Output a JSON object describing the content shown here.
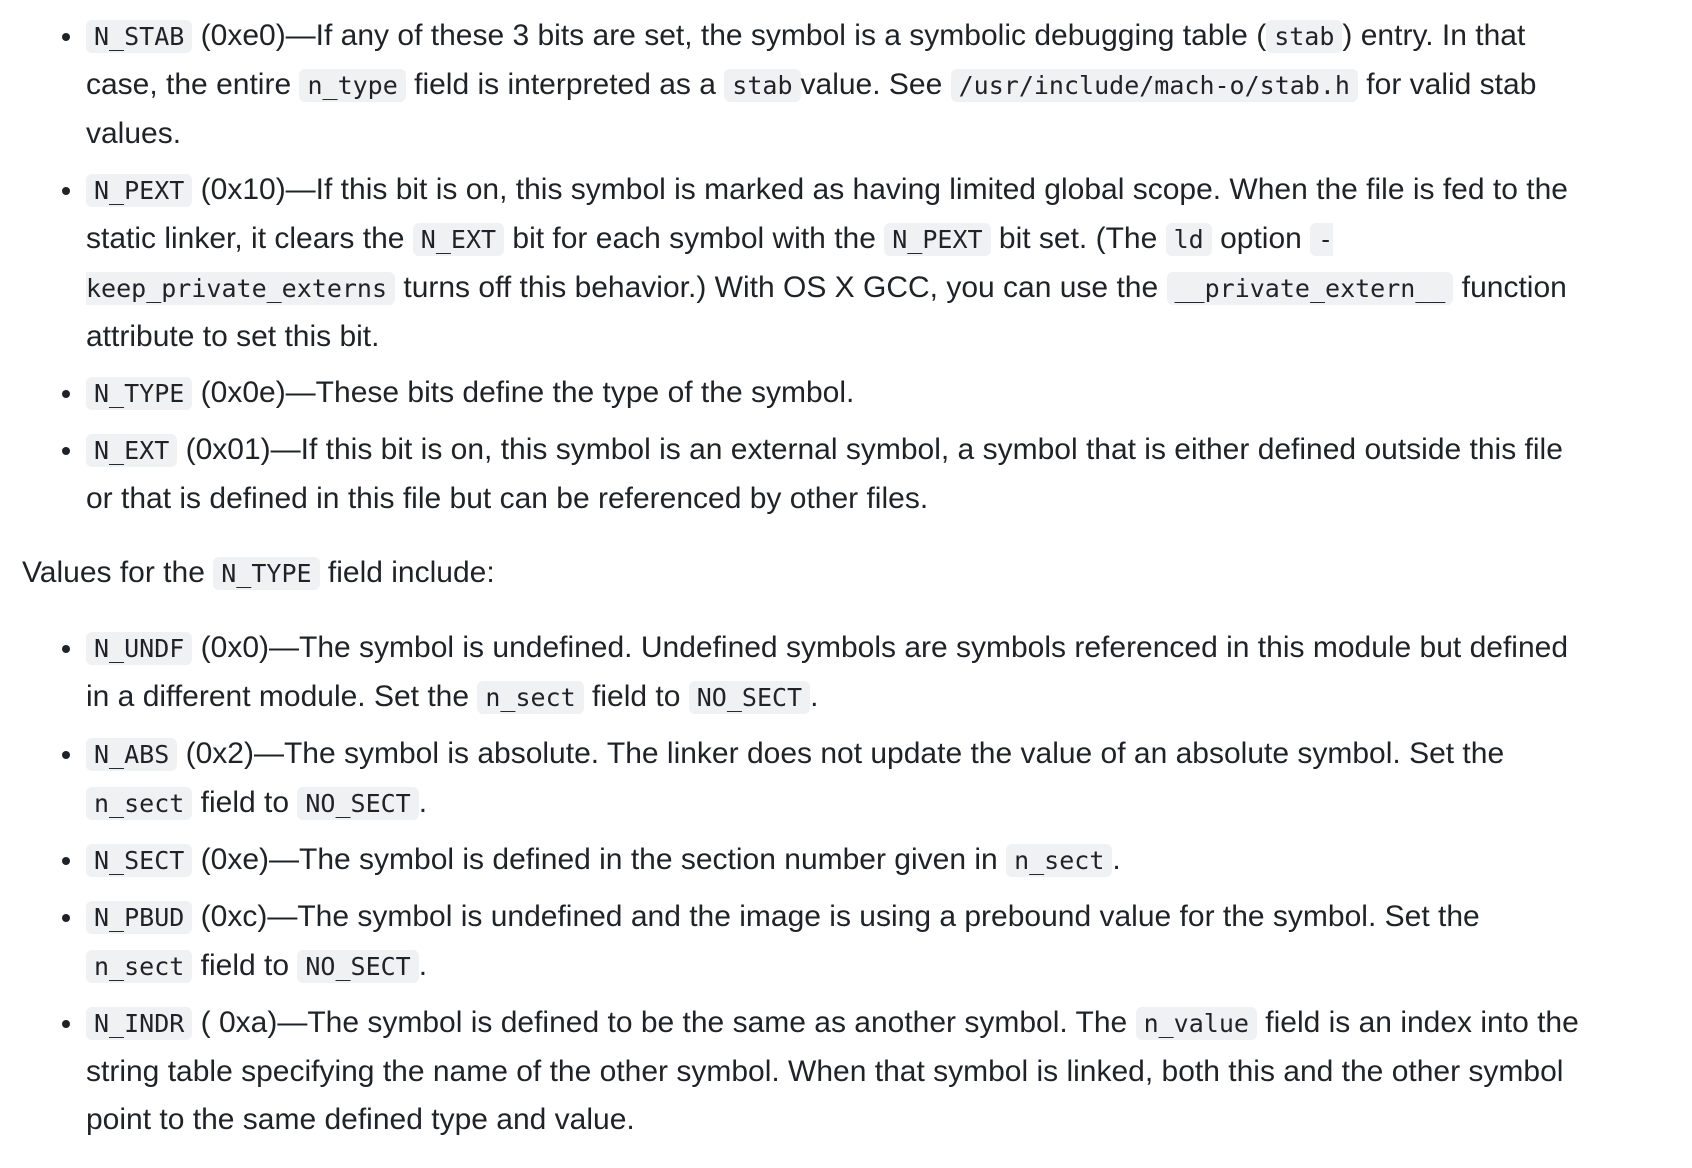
{
  "list1": [
    {
      "code": "N_STAB",
      "t1": " (0xe0)—If any of these 3 bits are set, the symbol is a symbolic debugging table (",
      "c2": "stab",
      "t2": ") entry. In that case, the entire ",
      "c3": "n_type",
      "t3": " field is interpreted as a ",
      "c4": "stab",
      "t4": "value. See ",
      "c5": "/usr/include/mach-o/stab.h",
      "t5": " for valid stab values."
    },
    {
      "code": "N_PEXT",
      "t1": " (0x10)—If this bit is on, this symbol is marked as having limited global scope. When the file is fed to the static linker, it clears the ",
      "c2": "N_EXT",
      "t2": " bit for each symbol with the ",
      "c3": "N_PEXT",
      "t3": " bit set. (The ",
      "c4": "ld",
      "t4": " option ",
      "c5": "-keep_private_externs",
      "t5": " turns off this behavior.) With OS X GCC, you can use the ",
      "c6": "__private_extern__",
      "t6": " function attribute to set this bit."
    },
    {
      "code": "N_TYPE",
      "t1": " (0x0e)—These bits define the type of the symbol."
    },
    {
      "code": "N_EXT",
      "t1": " (0x01)—If this bit is on, this symbol is an external symbol, a symbol that is either defined outside this file or that is defined in this file but can be referenced by other files."
    }
  ],
  "para": {
    "t1": "Values for the ",
    "c1": "N_TYPE",
    "t2": " field include:"
  },
  "list2": [
    {
      "code": "N_UNDF",
      "t1": " (0x0)—The symbol is undefined. Undefined symbols are symbols referenced in this module but defined in a different module. Set the ",
      "c2": "n_sect",
      "t2": " field to ",
      "c3": "NO_SECT",
      "t3": "."
    },
    {
      "code": "N_ABS",
      "t1": " (0x2)—The symbol is absolute. The linker does not update the value of an absolute symbol. Set the ",
      "c2": "n_sect",
      "t2": " field to ",
      "c3": "NO_SECT",
      "t3": "."
    },
    {
      "code": "N_SECT",
      "t1": " (0xe)—The symbol is defined in the section number given in ",
      "c2": "n_sect",
      "t2": "."
    },
    {
      "code": "N_PBUD",
      "t1": " (0xc)—The symbol is undefined and the image is using a prebound value for the symbol. Set the ",
      "c2": "n_sect",
      "t2": " field to ",
      "c3": "NO_SECT",
      "t3": "."
    },
    {
      "code": "N_INDR",
      "t1": " ( 0xa)—The symbol is defined to be the same as another symbol. The ",
      "c2": "n_value",
      "t2": " field is an index into the string table specifying the name of the other symbol. When that symbol is linked, both this and the other symbol point to the same defined type and value."
    }
  ]
}
